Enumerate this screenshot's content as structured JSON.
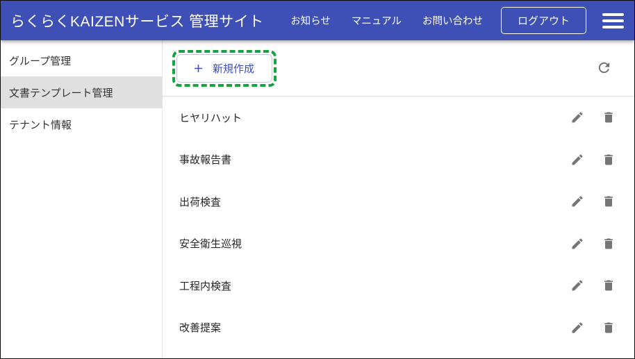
{
  "header": {
    "title": "らくらくKAIZENサービス 管理サイト",
    "nav": [
      {
        "label": "お知らせ"
      },
      {
        "label": "マニュアル"
      },
      {
        "label": "お問い合わせ"
      }
    ],
    "logout_label": "ログアウト",
    "menu_icon": "hamburger-icon"
  },
  "sidebar": {
    "items": [
      {
        "label": "グループ管理",
        "selected": false
      },
      {
        "label": "文書テンプレート管理",
        "selected": true
      },
      {
        "label": "テナント情報",
        "selected": false
      }
    ]
  },
  "toolbar": {
    "create_label": "新規作成",
    "create_icon": "plus-icon",
    "refresh_icon": "refresh-icon",
    "annotation": "green-dashed-highlight"
  },
  "list": {
    "rows": [
      {
        "label": "ヒヤリハット"
      },
      {
        "label": "事故報告書"
      },
      {
        "label": "出荷検査"
      },
      {
        "label": "安全衛生巡視"
      },
      {
        "label": "工程内検査"
      },
      {
        "label": "改善提案"
      }
    ],
    "row_actions": [
      {
        "icon": "pencil-icon",
        "action": "edit"
      },
      {
        "icon": "trash-icon",
        "action": "delete"
      }
    ]
  },
  "colors": {
    "header_bg": "#3e4fb5",
    "accent": "#3e4fb5",
    "annotation_green": "#17a342",
    "icon_gray": "#757575",
    "selected_bg": "#e0e0e0"
  }
}
